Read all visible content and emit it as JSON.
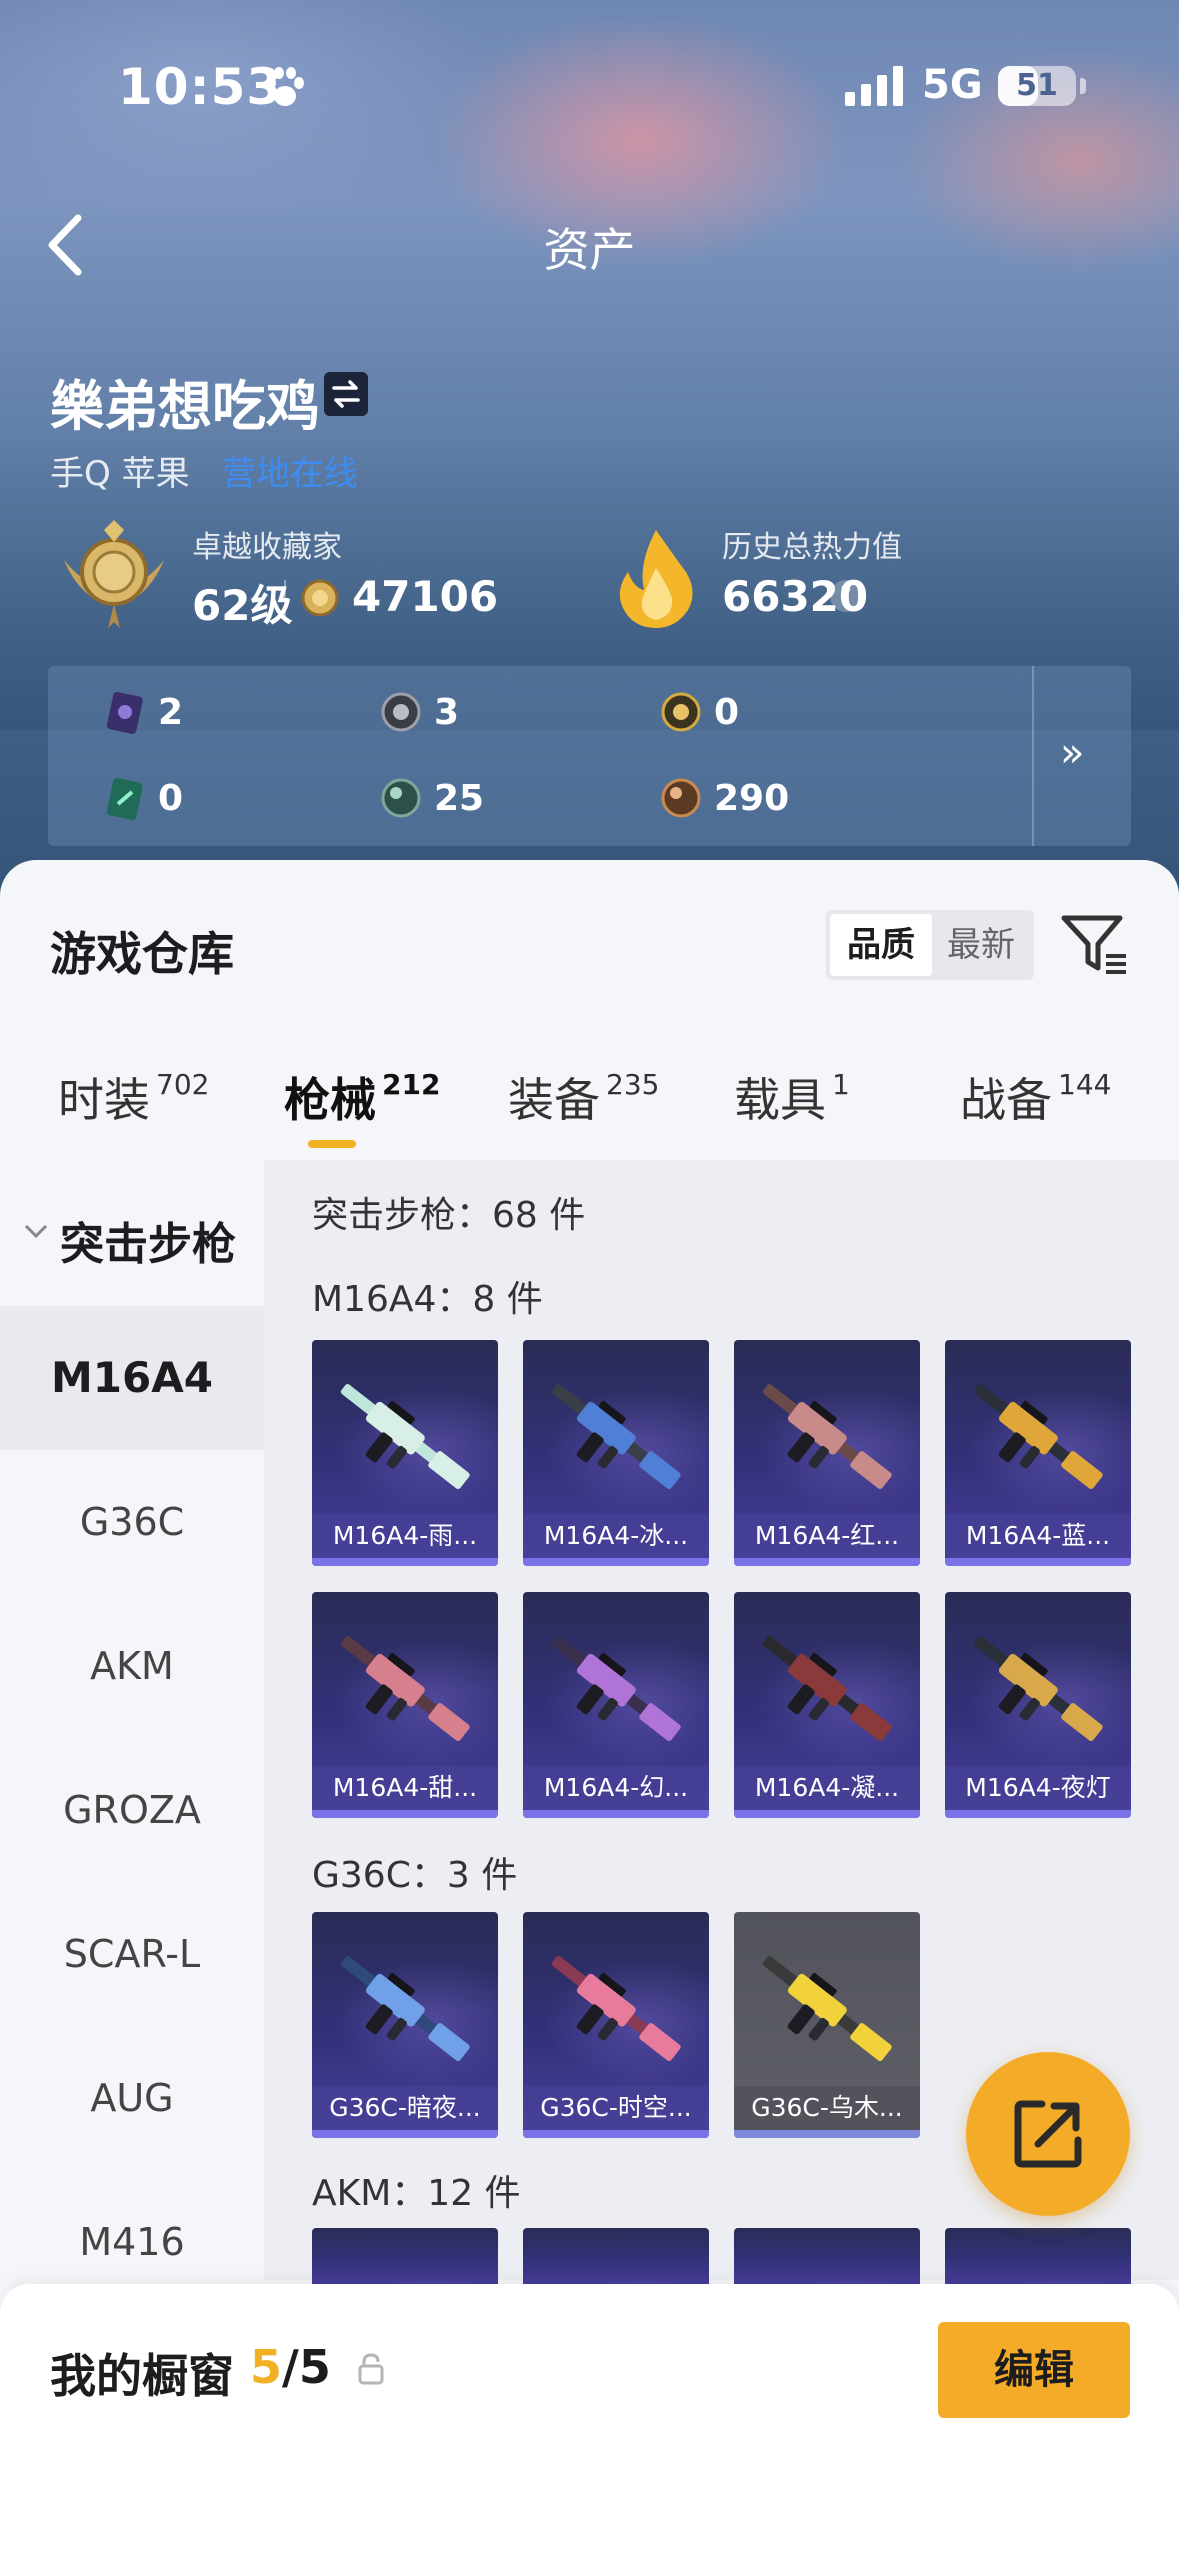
{
  "status_bar": {
    "time": "10:53",
    "network": "5G",
    "battery": "51",
    "battery_level": 0.51
  },
  "nav": {
    "title": "资产"
  },
  "profile": {
    "name": "樂弟想吃鸡",
    "platform": "手Q 苹果",
    "status": "营地在线",
    "collector_label": "卓越收藏家",
    "level": "62级",
    "coins": "47106",
    "heat_label": "历史总热力值",
    "heat_value": "66320",
    "help": "?"
  },
  "resources": {
    "items": [
      {
        "icon": "card-purple-icon",
        "value": "2"
      },
      {
        "icon": "coin-silver-icon",
        "value": "3"
      },
      {
        "icon": "coin-gold-icon",
        "value": "0"
      },
      {
        "icon": "card-green-icon",
        "value": "0"
      },
      {
        "icon": "orb-green-icon",
        "value": "25"
      },
      {
        "icon": "orb-bronze-icon",
        "value": "290"
      }
    ],
    "more": "»"
  },
  "warehouse": {
    "title": "游戏仓库",
    "sort_quality": "品质",
    "sort_newest": "最新"
  },
  "tabs": [
    {
      "label": "时装",
      "count": "702"
    },
    {
      "label": "枪械",
      "count": "212"
    },
    {
      "label": "装备",
      "count": "235"
    },
    {
      "label": "载具",
      "count": "1"
    },
    {
      "label": "战备",
      "count": "144"
    }
  ],
  "category": {
    "name": "突击步枪",
    "items": [
      "M16A4",
      "G36C",
      "AKM",
      "GROZA",
      "SCAR-L",
      "AUG",
      "M416"
    ]
  },
  "sections": {
    "total": "突击步枪：68 件",
    "m16": "M16A4：8 件",
    "g36": "G36C：3 件",
    "akm": "AKM：12 件"
  },
  "cards": {
    "m16": [
      "M16A4-雨...",
      "M16A4-冰...",
      "M16A4-红...",
      "M16A4-蓝...",
      "M16A4-甜...",
      "M16A4-幻...",
      "M16A4-凝...",
      "M16A4-夜灯"
    ],
    "g36": [
      "G36C-暗夜...",
      "G36C-时空...",
      "G36C-乌木..."
    ]
  },
  "showcase": {
    "label": "我的橱窗",
    "current": "5",
    "total": "/5",
    "edit": "编辑"
  },
  "colors": {
    "accent": "#f4ac28",
    "link": "#3f8cf0",
    "card": "#33317a"
  }
}
